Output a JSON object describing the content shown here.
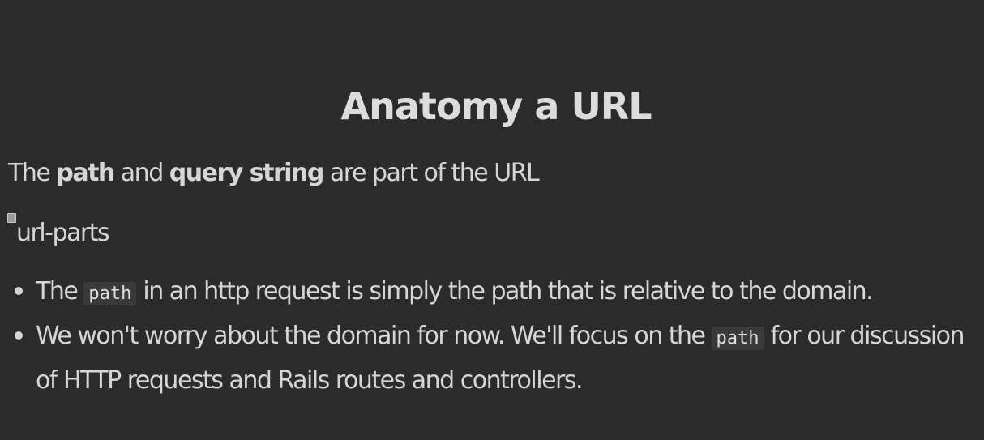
{
  "slide": {
    "title": "Anatomy a URL",
    "intro": {
      "prefix": "The ",
      "bold_path": "path",
      "middle": " and ",
      "bold_query": "query string",
      "suffix": " are part of the URL"
    },
    "image_alt": "url-parts",
    "bullets": [
      {
        "before": "The ",
        "code": "path",
        "after": " in an http request is simply the path that is relative to the domain."
      },
      {
        "before": "We won't worry about the domain for now. We'll focus on the ",
        "code": "path",
        "after": " for our discussion of HTTP requests and Rails routes and controllers."
      }
    ]
  }
}
